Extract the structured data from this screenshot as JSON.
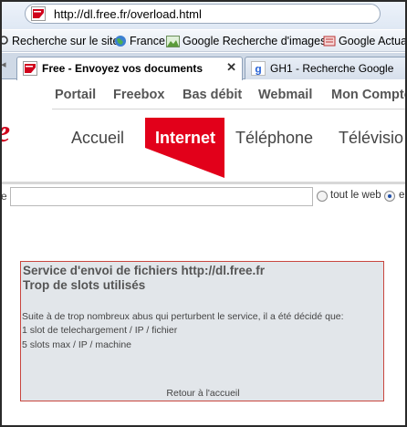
{
  "browser": {
    "url": "http://dl.free.fr/overload.html",
    "bookmarks": [
      {
        "label": "Recherche sur le site",
        "icon": "search-magnifier-icon"
      },
      {
        "label": "France",
        "icon": "globe-icon"
      },
      {
        "label": "Google Recherche d'images",
        "icon": "image-icon"
      },
      {
        "label": "Google Actua",
        "icon": "news-icon"
      }
    ],
    "tabs": [
      {
        "label": "Free - Envoyez vos documents",
        "active": true,
        "close": "✕"
      },
      {
        "label": "GH1 - Recherche Google",
        "active": false
      }
    ]
  },
  "site": {
    "topnav": [
      "Portail",
      "Freebox",
      "Bas débit",
      "Webmail",
      "Mon Compte"
    ],
    "mainnav": [
      "Accueil",
      "Internet",
      "Téléphone",
      "Télévisio"
    ],
    "active_nav": "Internet",
    "brand_color": "#e2001a",
    "search": {
      "left_char": "e",
      "value": "",
      "options": [
        {
          "label": "tout le web",
          "checked": false
        },
        {
          "label": "e",
          "checked": true
        }
      ]
    }
  },
  "content": {
    "title": "Service d'envoi de fichiers http://dl.free.fr",
    "subtitle": "Trop de slots utilisés",
    "lines": [
      "Suite à de trop nombreux abus qui perturbent le service, il a été décidé que:",
      "1 slot de telechargement / IP / fichier",
      "5 slots max / IP / machine"
    ],
    "back_link": "Retour à l'accueil"
  }
}
